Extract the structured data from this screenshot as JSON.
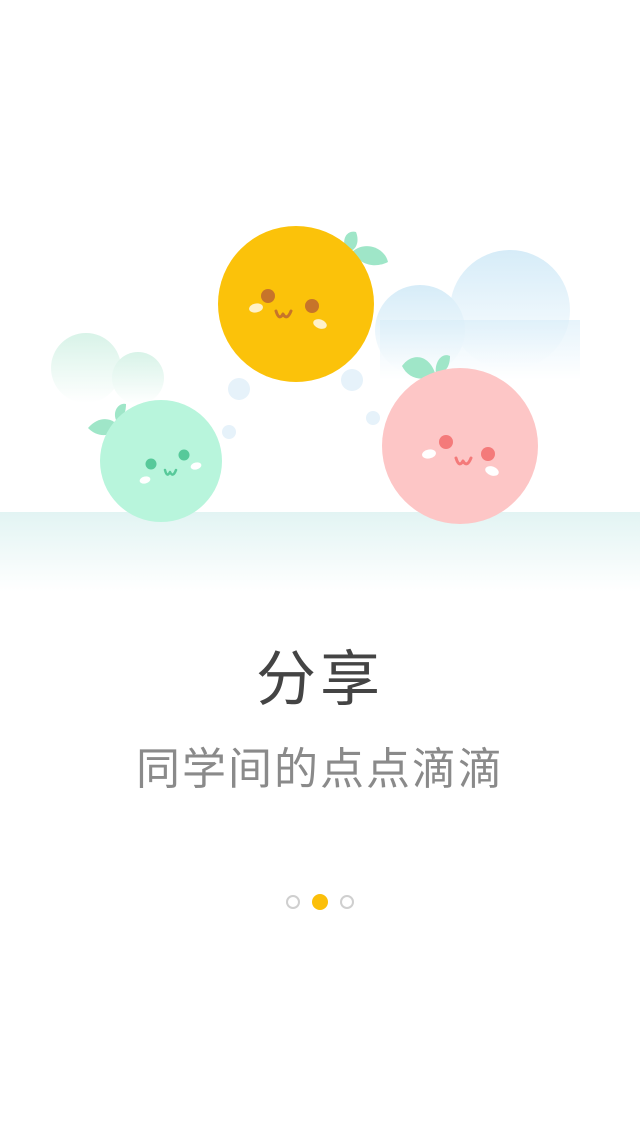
{
  "onboarding": {
    "title": "分享",
    "subtitle": "同学间的点点滴滴",
    "pager": {
      "total": 3,
      "current_index": 1
    }
  },
  "colors": {
    "yellow_fruit": "#fbc20a",
    "pink_fruit": "#fdc6c6",
    "mint_fruit": "#b8f5dc",
    "leaf": "#9fe6c8",
    "active_dot": "#fbbf0a",
    "title_text": "#444444",
    "subtitle_text": "#8a8a8a"
  }
}
